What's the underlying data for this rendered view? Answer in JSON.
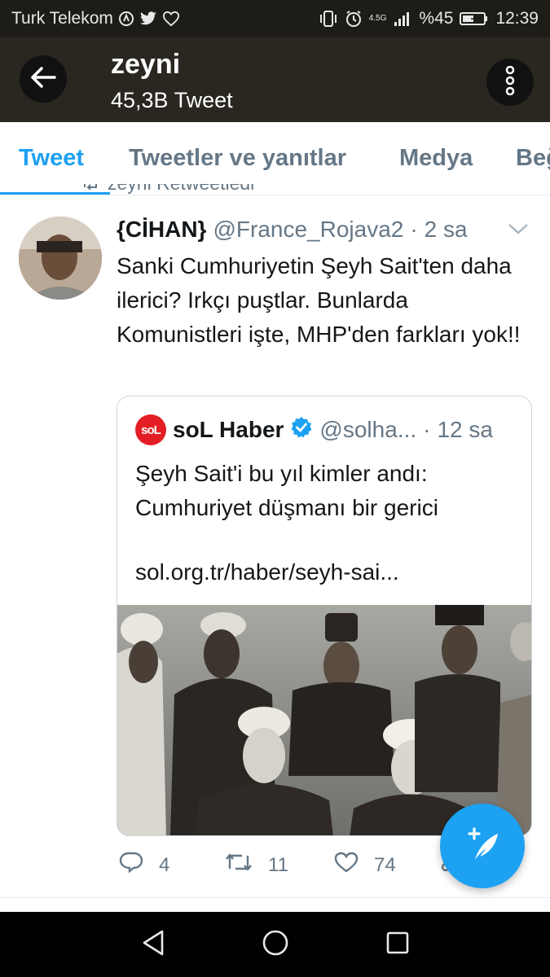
{
  "status_bar": {
    "carrier": "Turk Telekom",
    "network": "4.5G",
    "battery": "%45",
    "time": "12:39"
  },
  "header": {
    "title": "zeyni",
    "subtitle": "45,3B Tweet"
  },
  "tabs": [
    {
      "label": "Tweet",
      "active": true
    },
    {
      "label": "Tweetler ve yanıtlar",
      "active": false
    },
    {
      "label": "Medya",
      "active": false
    },
    {
      "label": "Beğeni",
      "active": false
    }
  ],
  "retweet_header": "zeyni Retweetledi",
  "tweet": {
    "name": "{CİHAN}",
    "handle": "@France_Rojava2",
    "separator": "·",
    "time": "2 sa",
    "text": "Sanki Cumhuriyetin Şeyh Sait'ten daha ilerici? Irkçı puştlar. Bunlarda Komunistleri işte, MHP'den farkları yok!!"
  },
  "quoted_tweet": {
    "logo_text": "soL",
    "name": "soL Haber",
    "handle": "@solha...",
    "separator": "·",
    "time": "12 sa",
    "text": "Şeyh Sait'i bu yıl kimler andı: Cumhuriyet düşmanı bir gerici",
    "link": "sol.org.tr/haber/seyh-sai..."
  },
  "actions": {
    "replies": "4",
    "retweets": "11",
    "likes": "74"
  },
  "colors": {
    "accent": "#1da1f2",
    "appbar": "#2a2721",
    "statusbar": "#1e1c17",
    "secondary_text": "#657786",
    "logo_red": "#e31e24"
  },
  "icons": [
    "back-arrow-icon",
    "more-vertical-icon",
    "chevron-down-icon",
    "verified-badge-icon",
    "reply-icon",
    "retweet-icon",
    "like-icon",
    "compose-icon",
    "nav-back-icon",
    "nav-home-icon",
    "nav-recents-icon"
  ]
}
